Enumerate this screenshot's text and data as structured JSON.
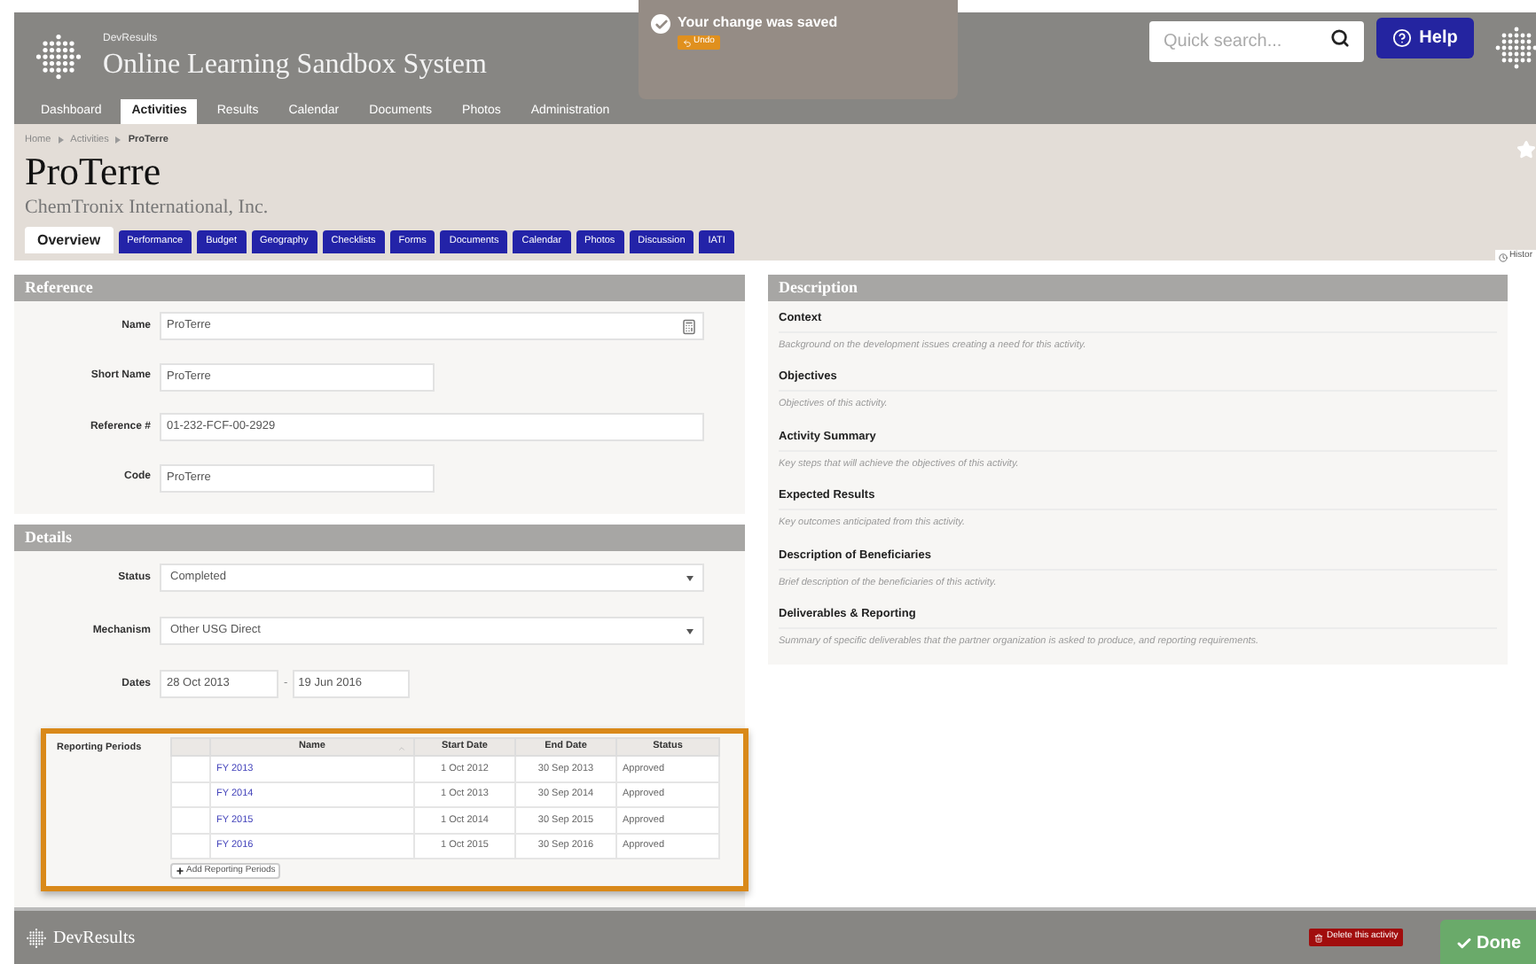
{
  "header": {
    "brand_small": "DevResults",
    "brand": "Online Learning Sandbox System",
    "search": {
      "placeholder": "Quick search..."
    },
    "help": "Help"
  },
  "toast": {
    "message": "Your change was saved",
    "undo": "Undo"
  },
  "nav": [
    {
      "label": "Dashboard",
      "selected": false
    },
    {
      "label": "Activities",
      "selected": true
    },
    {
      "label": "Results",
      "selected": false
    },
    {
      "label": "Calendar",
      "selected": false
    },
    {
      "label": "Documents",
      "selected": false
    },
    {
      "label": "Photos",
      "selected": false
    },
    {
      "label": "Administration",
      "selected": false
    }
  ],
  "breadcrumb": [
    "Home",
    "Activities",
    "ProTerre"
  ],
  "title": "ProTerre",
  "subtitle": "ChemTronix International, Inc.",
  "tabs": [
    {
      "label": "Overview",
      "selected": true
    },
    {
      "label": "Performance",
      "selected": false
    },
    {
      "label": "Budget",
      "selected": false
    },
    {
      "label": "Geography",
      "selected": false
    },
    {
      "label": "Checklists",
      "selected": false
    },
    {
      "label": "Forms",
      "selected": false
    },
    {
      "label": "Documents",
      "selected": false
    },
    {
      "label": "Calendar",
      "selected": false
    },
    {
      "label": "Photos",
      "selected": false
    },
    {
      "label": "Discussion",
      "selected": false
    },
    {
      "label": "IATI",
      "selected": false
    }
  ],
  "history": "Histor",
  "reference": {
    "title": "Reference",
    "fields": [
      {
        "label": "Name",
        "value": "ProTerre",
        "kind": "wide-icon"
      },
      {
        "label": "Short Name",
        "value": "ProTerre",
        "kind": "short"
      },
      {
        "label": "Reference #",
        "value": "01-232-FCF-00-2929",
        "kind": "wide"
      },
      {
        "label": "Code",
        "value": "ProTerre",
        "kind": "short"
      }
    ]
  },
  "details": {
    "title": "Details",
    "selects": [
      {
        "label": "Status",
        "value": "Completed"
      },
      {
        "label": "Mechanism",
        "value": "Other USG Direct"
      }
    ],
    "dates": {
      "label": "Dates",
      "start": "28 Oct 2013",
      "separator": "-",
      "end": "19 Jun 2016"
    },
    "reporting_periods": {
      "label": "Reporting Periods",
      "columns": [
        "Name",
        "Start Date",
        "End Date",
        "Status"
      ],
      "rows": [
        {
          "name": "FY 2013",
          "start": "1 Oct 2012",
          "end": "30 Sep 2013",
          "status": "Approved"
        },
        {
          "name": "FY 2014",
          "start": "1 Oct 2013",
          "end": "30 Sep 2014",
          "status": "Approved"
        },
        {
          "name": "FY 2015",
          "start": "1 Oct 2014",
          "end": "30 Sep 2015",
          "status": "Approved"
        },
        {
          "name": "FY 2016",
          "start": "1 Oct 2015",
          "end": "30 Sep 2016",
          "status": "Approved"
        }
      ],
      "add": "Add Reporting Periods"
    }
  },
  "description": {
    "title": "Description",
    "items": [
      {
        "heading": "Context",
        "placeholder": "Background on the development issues creating a need for this activity."
      },
      {
        "heading": "Objectives",
        "placeholder": "Objectives of this activity."
      },
      {
        "heading": "Activity Summary",
        "placeholder": "Key steps that will achieve the objectives of this activity."
      },
      {
        "heading": "Expected Results",
        "placeholder": "Key outcomes anticipated from this activity."
      },
      {
        "heading": "Description of Beneficiaries",
        "placeholder": "Brief description of the beneficiaries of this activity."
      },
      {
        "heading": "Deliverables & Reporting",
        "placeholder": "Summary of specific deliverables that the partner organization is asked to produce, and reporting requirements."
      }
    ]
  },
  "footer": {
    "brand": "DevResults",
    "delete": "Delete this activity",
    "done": "Done"
  }
}
